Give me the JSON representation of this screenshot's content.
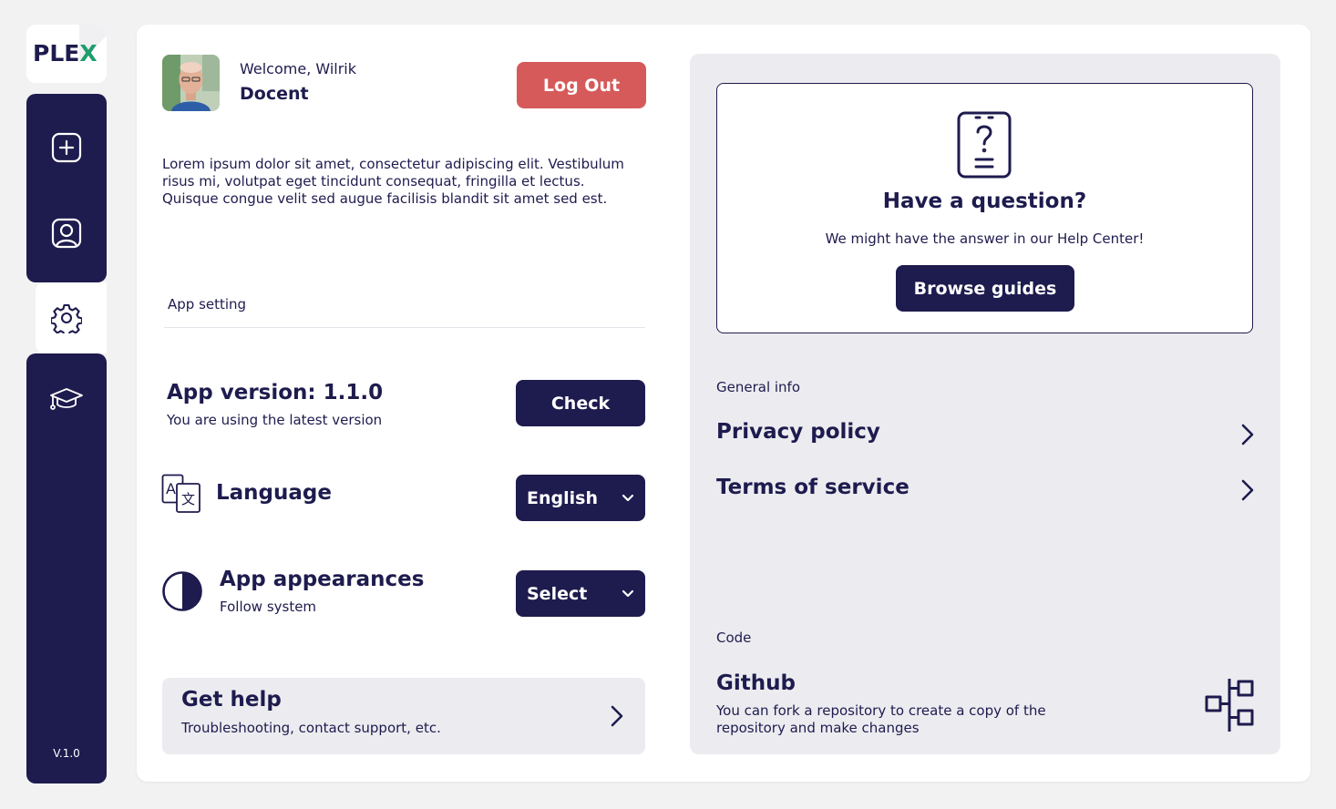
{
  "sidebar": {
    "logo": {
      "main": "PLE",
      "accent": "X"
    },
    "items": [
      {
        "name": "add",
        "icon": "plus-square-icon"
      },
      {
        "name": "profile",
        "icon": "user-portrait-icon"
      },
      {
        "name": "settings",
        "icon": "gear-icon",
        "active": true
      },
      {
        "name": "courses",
        "icon": "graduation-cap-icon"
      }
    ],
    "version": "V.1.0"
  },
  "user": {
    "welcome": "Welcome, Wilrik",
    "role": "Docent",
    "logout_label": "Log Out"
  },
  "intro_text": "Lorem ipsum dolor sit amet, consectetur adipiscing elit. Vestibulum risus mi, volutpat eget tincidunt consequat, fringilla et lectus. Quisque congue velit sed augue facilisis blandit sit amet sed est.",
  "settings": {
    "section_label": "App setting",
    "version": {
      "title": "App version: 1.1.0",
      "status": "You are using the latest version",
      "check_label": "Check"
    },
    "language": {
      "title": "Language",
      "selected": "English"
    },
    "appearance": {
      "title": "App appearances",
      "subtitle": "Follow system",
      "selected": "Select"
    }
  },
  "help": {
    "title": "Get help",
    "subtitle": "Troubleshooting, contact support, etc."
  },
  "question_card": {
    "title": "Have a question?",
    "subtitle": "We might have the answer in our Help Center!",
    "button_label": "Browse guides"
  },
  "general_info": {
    "label": "General info",
    "links": [
      "Privacy policy",
      "Terms of service"
    ]
  },
  "code": {
    "label": "Code",
    "title": "Github",
    "description": "You can fork a repository to create a copy of the repository and make changes"
  },
  "colors": {
    "primary": "#1e1b4e",
    "danger": "#d65a5a",
    "accent": "#1f9d6c",
    "panel": "#ececf0"
  }
}
